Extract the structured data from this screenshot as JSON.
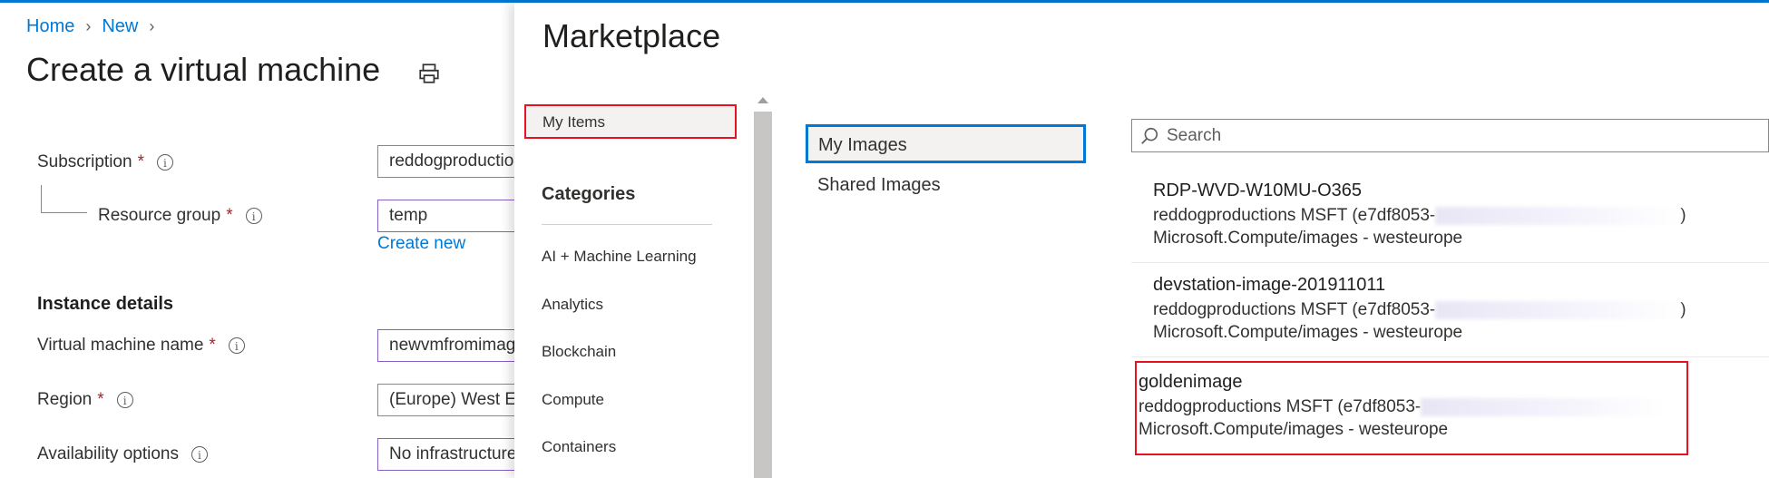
{
  "breadcrumb": {
    "home": "Home",
    "new": "New"
  },
  "page": {
    "title": "Create a virtual machine"
  },
  "form": {
    "subscription": {
      "label": "Subscription",
      "value": "reddogproduction"
    },
    "resource_group": {
      "label": "Resource group",
      "value": "temp",
      "create_new": "Create new"
    },
    "instance_details": "Instance details",
    "vm_name": {
      "label": "Virtual machine name",
      "value": "newvmfromimage"
    },
    "region": {
      "label": "Region",
      "value": "(Europe) West Eu"
    },
    "availability": {
      "label": "Availability options",
      "value": "No infrastructure"
    },
    "required_mark": "*",
    "info_glyph": "i"
  },
  "marketplace": {
    "title": "Marketplace",
    "my_items": "My Items",
    "categories_heading": "Categories",
    "categories": [
      "AI + Machine Learning",
      "Analytics",
      "Blockchain",
      "Compute",
      "Containers"
    ],
    "image_tabs": {
      "my_images": "My Images",
      "shared_images": "Shared Images"
    },
    "search_placeholder": "Search",
    "results": [
      {
        "name": "RDP-WVD-W10MU-O365",
        "publisher": "reddogproductions MSFT (e7df8053-",
        "publisher_end": ")",
        "type": "Microsoft.Compute/images  - westeurope"
      },
      {
        "name": "devstation-image-201911011",
        "publisher": "reddogproductions MSFT (e7df8053-",
        "publisher_end": ")",
        "type": "Microsoft.Compute/images  - westeurope"
      },
      {
        "name": "goldenimage",
        "publisher": "reddogproductions MSFT (e7df8053-",
        "publisher_end": "",
        "type": "Microsoft.Compute/images  - westeurope"
      }
    ]
  },
  "colors": {
    "accent": "#0078d4",
    "highlight": "#e81123",
    "required": "#a4262c",
    "purple_border": "#8661c5"
  },
  "icons": [
    "print-icon",
    "info-icon",
    "search-icon",
    "chevron-right-icon"
  ]
}
